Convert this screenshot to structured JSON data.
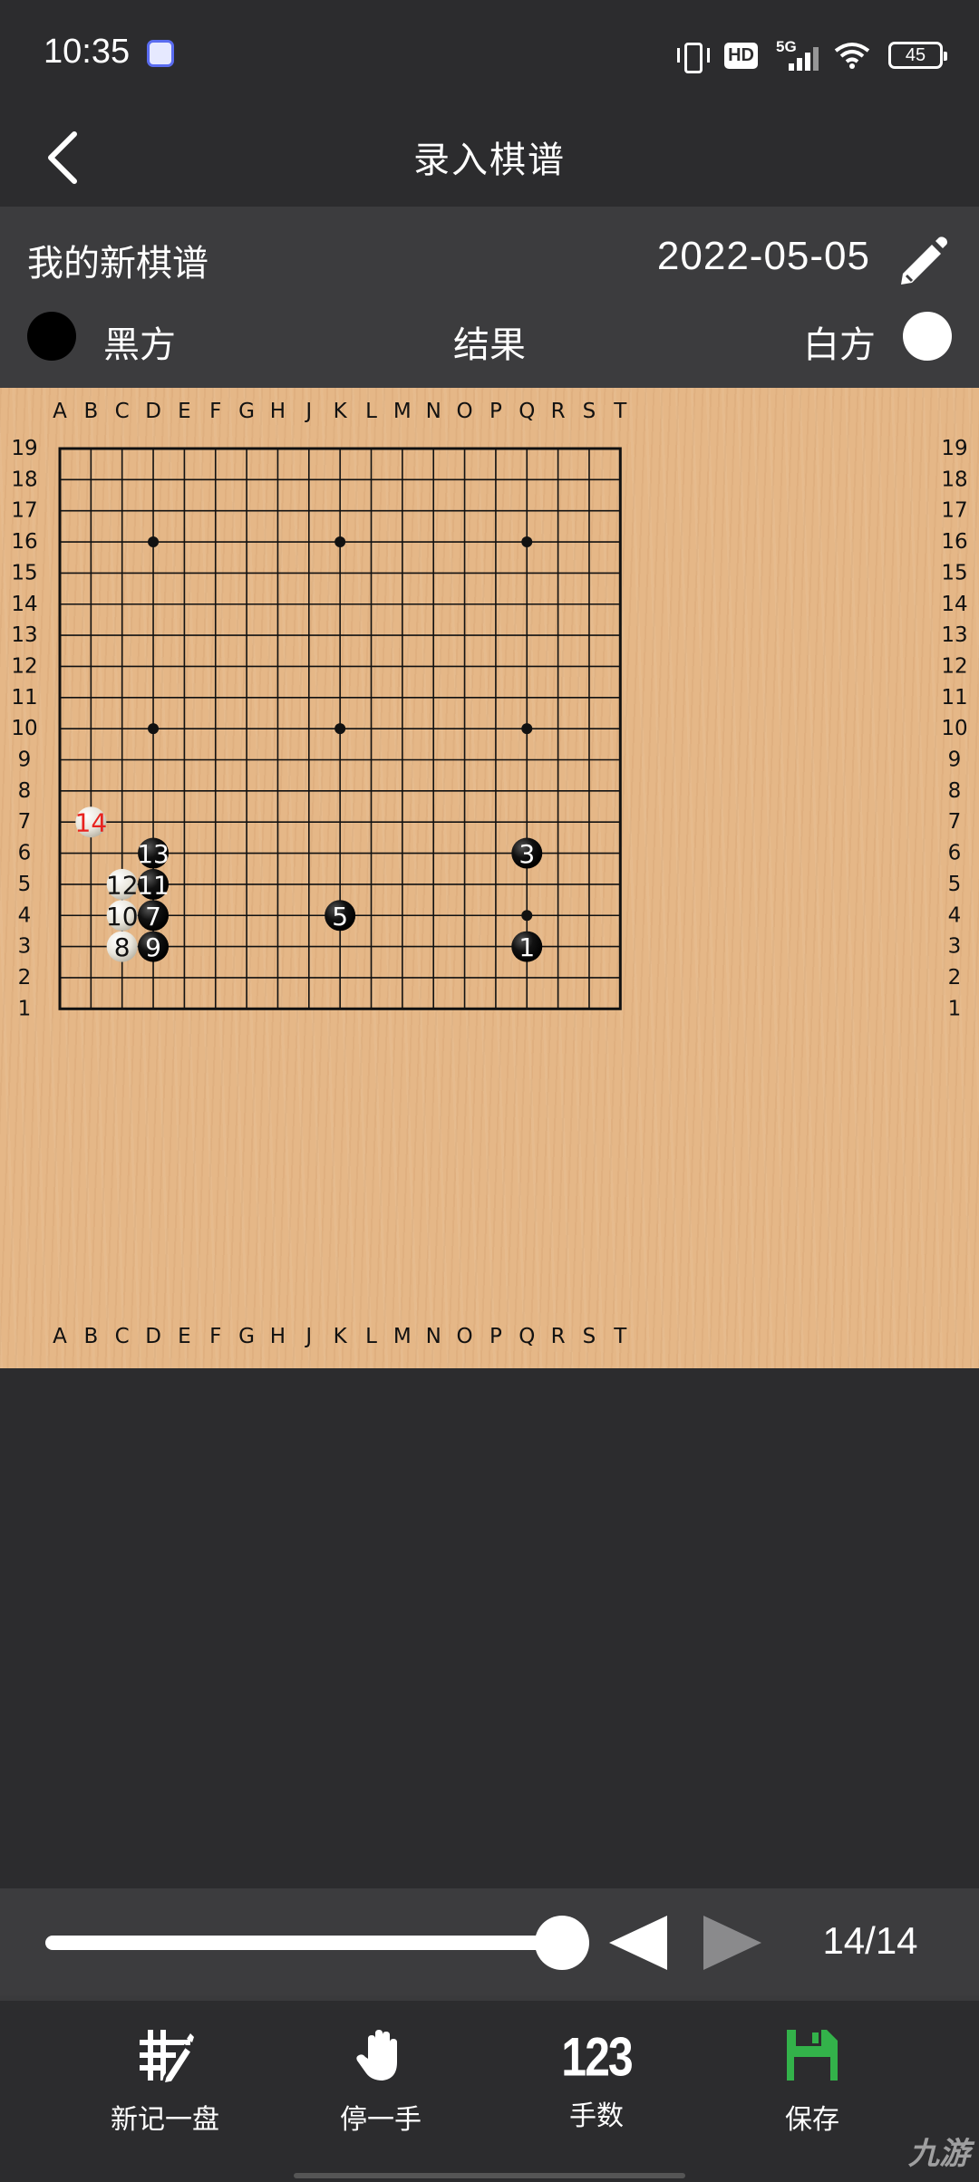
{
  "status_bar": {
    "time": "10:35",
    "network": "5G",
    "hd_badge": "HD",
    "battery": "45"
  },
  "header": {
    "title": "录入棋谱"
  },
  "record": {
    "name": "我的新棋谱",
    "date": "2022-05-05",
    "black_label": "黑方",
    "result_label": "结果",
    "white_label": "白方"
  },
  "board": {
    "size": 19,
    "columns": [
      "A",
      "B",
      "C",
      "D",
      "E",
      "F",
      "G",
      "H",
      "J",
      "K",
      "L",
      "M",
      "N",
      "O",
      "P",
      "Q",
      "R",
      "S",
      "T"
    ],
    "rows": [
      "19",
      "18",
      "17",
      "16",
      "15",
      "14",
      "13",
      "12",
      "11",
      "10",
      "9",
      "8",
      "7",
      "6",
      "5",
      "4",
      "3",
      "2",
      "1"
    ],
    "star_points": [
      "D16",
      "K16",
      "Q16",
      "D10",
      "K10",
      "Q10",
      "Q4"
    ],
    "stones": [
      {
        "move": 1,
        "color": "black",
        "point": "Q3"
      },
      {
        "move": 3,
        "color": "black",
        "point": "Q6"
      },
      {
        "move": 5,
        "color": "black",
        "point": "K4"
      },
      {
        "move": 7,
        "color": "black",
        "point": "D4"
      },
      {
        "move": 8,
        "color": "white",
        "point": "C3"
      },
      {
        "move": 9,
        "color": "black",
        "point": "D3"
      },
      {
        "move": 10,
        "color": "white",
        "point": "C4"
      },
      {
        "move": 11,
        "color": "black",
        "point": "D5"
      },
      {
        "move": 12,
        "color": "white",
        "point": "C5"
      },
      {
        "move": 13,
        "color": "black",
        "point": "D6"
      },
      {
        "move": 14,
        "color": "white",
        "point": "B7",
        "last": true
      }
    ],
    "last_move_color": "#e8231f"
  },
  "playback": {
    "position": 1.0,
    "counter": "14/14"
  },
  "bottom_nav": {
    "new_game": "新记一盘",
    "pass": "停一手",
    "move_numbers_icon": "123",
    "move_numbers": "手数",
    "save": "保存",
    "save_color": "#33b24a"
  },
  "watermark": "九游"
}
